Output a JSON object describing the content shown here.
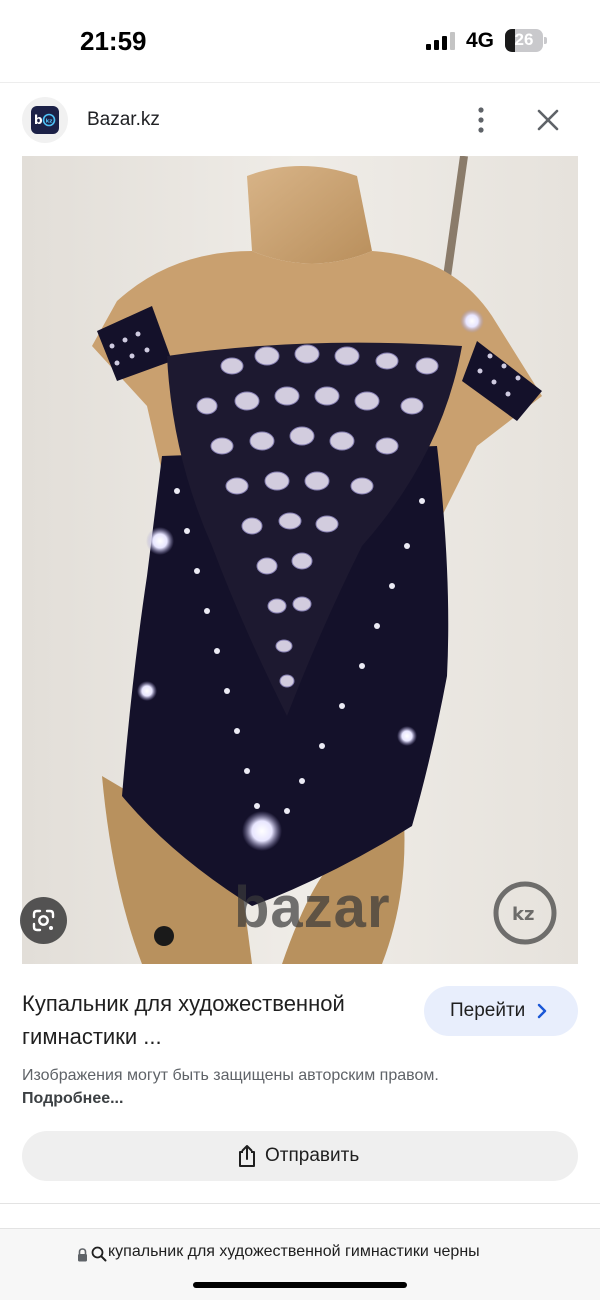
{
  "status_bar": {
    "time": "21:59",
    "network": "4G",
    "battery_percent": "26",
    "battery_level": 0.26,
    "signal_bars_active": 3
  },
  "header": {
    "site_name": "Bazar.kz",
    "logo_icon": "bazar-kz-logo",
    "more_icon": "more-vert-icon",
    "close_icon": "close-icon"
  },
  "image": {
    "watermark": "bazar kz",
    "lens_icon": "google-lens-icon"
  },
  "info": {
    "title": "Купальник для художественной гимнастики ...",
    "go_button_label": "Перейти",
    "copyright_text": "Изображения могут быть защищены авторским правом.",
    "copyright_more": "Подробнее...",
    "share_label": "Отправить"
  },
  "url_bar": {
    "text": "купальник для художественной гимнастики черны"
  },
  "colors": {
    "accent_button_bg": "#e8eefc",
    "logo_bg": "#1c2147",
    "leotard": "#14112a",
    "mannequin": "#c9a577"
  }
}
